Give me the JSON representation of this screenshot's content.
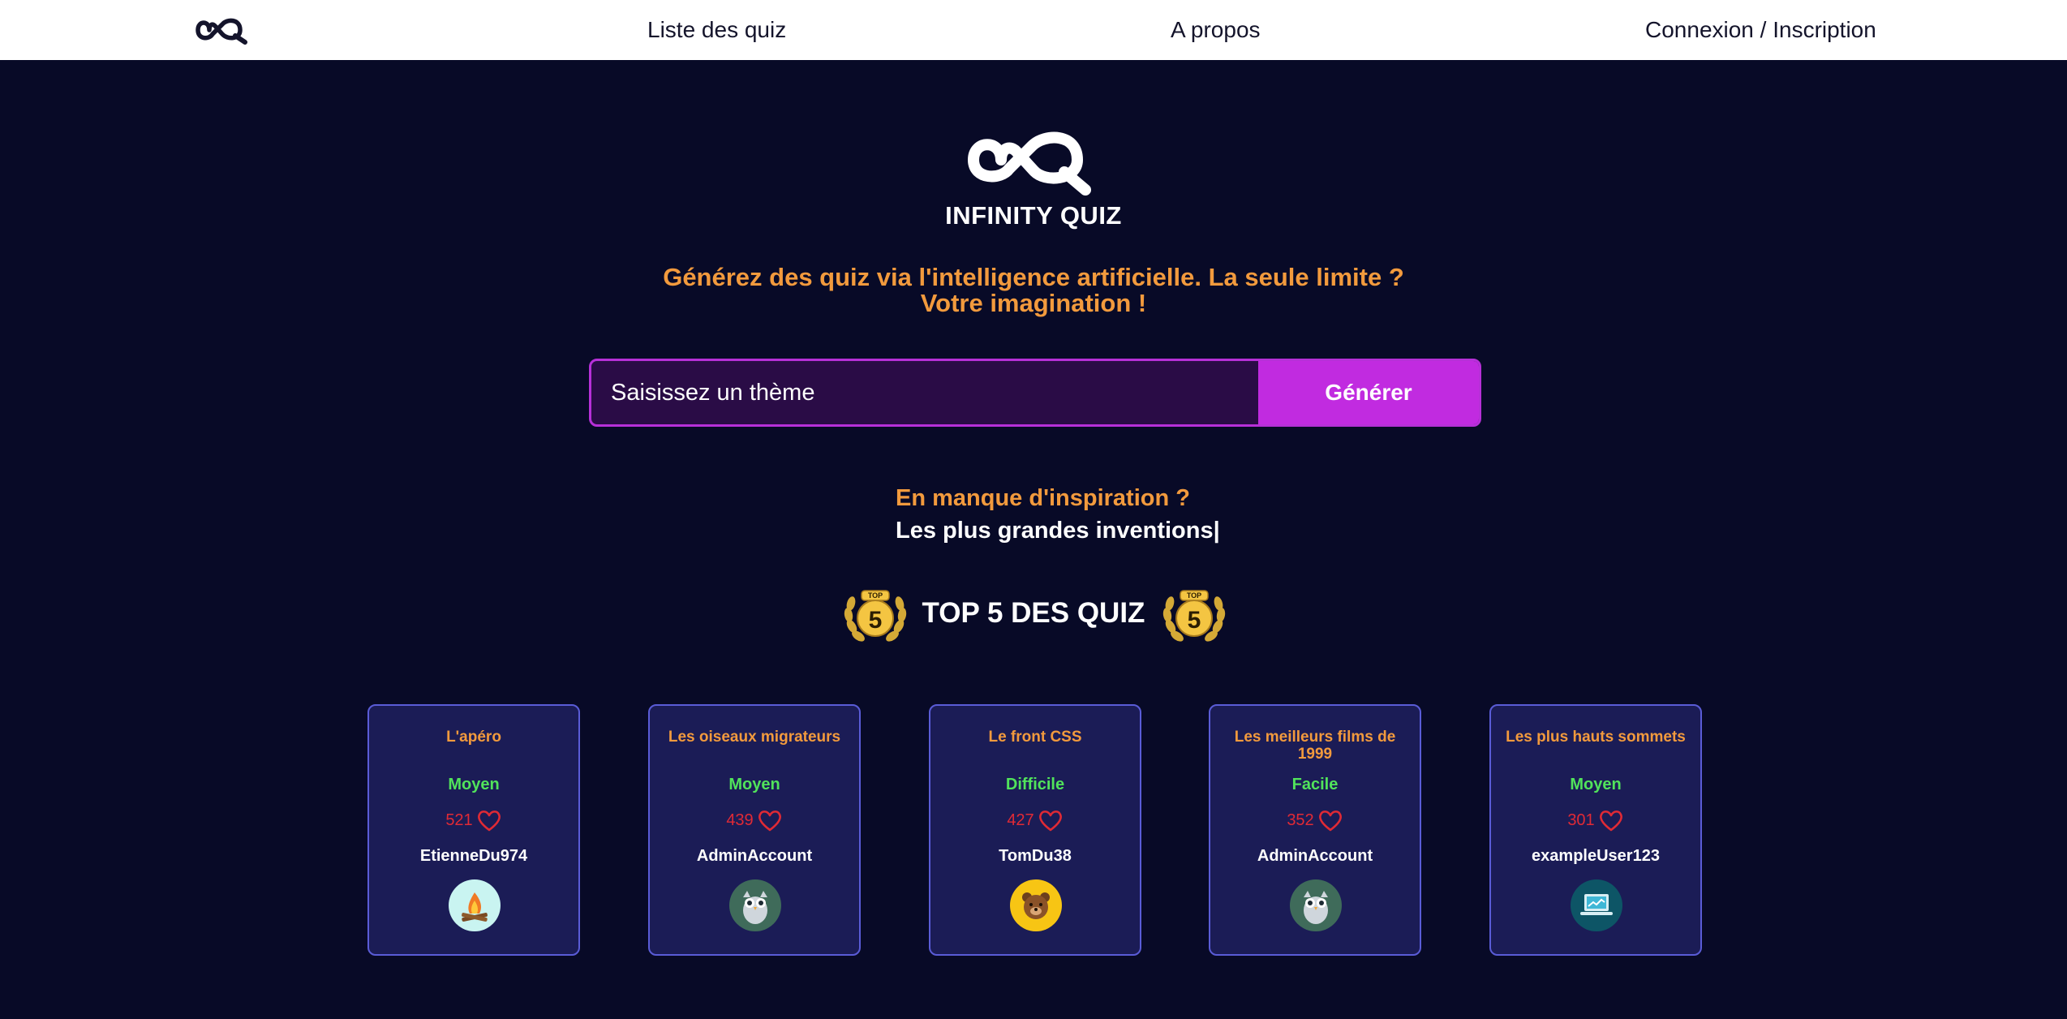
{
  "nav": {
    "logo_icon": "infinity-quiz-logo-icon",
    "links": [
      "Liste des quiz",
      "A propos",
      "Connexion / Inscription"
    ]
  },
  "hero": {
    "brand": "INFINITY QUIZ",
    "tagline_line1": "Générez des quiz via l'intelligence artificielle. La seule limite ?",
    "tagline_line2": "Votre imagination !"
  },
  "search": {
    "placeholder": "Saisissez un thème",
    "value": "",
    "button": "Générer"
  },
  "inspiration": {
    "label": "En manque d'inspiration ?",
    "example": "Les plus grandes inventions|"
  },
  "top5": {
    "title": "TOP 5 DES QUIZ",
    "badge_icon": "top5-laurel-badge-icon",
    "cards": [
      {
        "title": "L'apéro",
        "level": "Moyen",
        "likes": "521",
        "author": "EtienneDu974",
        "avatar": "campfire-avatar-icon"
      },
      {
        "title": "Les oiseaux migrateurs",
        "level": "Moyen",
        "likes": "439",
        "author": "AdminAccount",
        "avatar": "owl-avatar-icon"
      },
      {
        "title": "Le front CSS",
        "level": "Difficile",
        "likes": "427",
        "author": "TomDu38",
        "avatar": "bear-avatar-icon"
      },
      {
        "title": "Les meilleurs films de 1999",
        "level": "Facile",
        "likes": "352",
        "author": "AdminAccount",
        "avatar": "owl-avatar-icon"
      },
      {
        "title": "Les plus hauts sommets",
        "level": "Moyen",
        "likes": "301",
        "author": "exampleUser123",
        "avatar": "laptop-avatar-icon"
      }
    ]
  },
  "colors": {
    "background": "#080a27",
    "accent_orange": "#f29a3d",
    "accent_purple": "#c12be0",
    "card_bg": "#1b1c56",
    "card_border": "#5a5cd7",
    "level_green": "#51e35b",
    "like_red": "#e02a35"
  }
}
